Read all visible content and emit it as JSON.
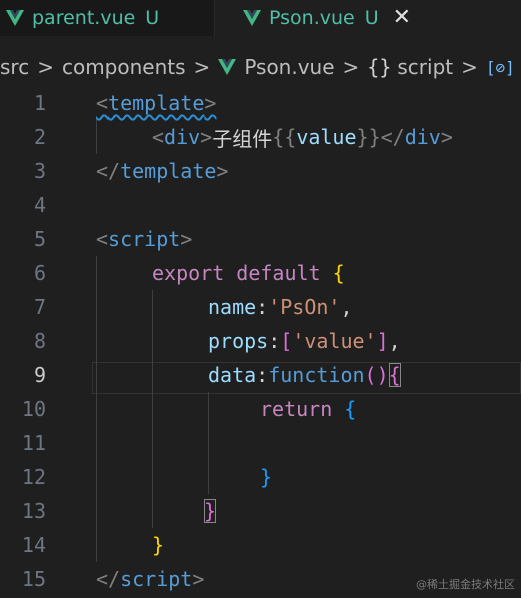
{
  "tabs": [
    {
      "label": "parent.vue",
      "status": "U"
    },
    {
      "label": "Pson.vue",
      "status": "U",
      "close": "✕"
    }
  ],
  "breadcrumb": {
    "items": [
      "src",
      "components",
      "Pson.vue",
      "script"
    ],
    "separator": ">",
    "braces": "{}",
    "symbol_glyph": "[⊘]"
  },
  "editor": {
    "line_numbers": [
      "1",
      "2",
      "3",
      "4",
      "5",
      "6",
      "7",
      "8",
      "9",
      "10",
      "11",
      "12",
      "13",
      "14",
      "15"
    ],
    "current_line": "9",
    "lines": [
      {
        "t1": "<",
        "t2": "template",
        "t3": ">"
      },
      {
        "t1": "<",
        "t2": "div",
        "t3": ">",
        "text": "子组件",
        "m1": "{{",
        "ident": "value",
        "m2": "}}",
        "t4": "</",
        "t5": "div",
        "t6": ">"
      },
      {
        "t1": "</",
        "t2": "template",
        "t3": ">"
      },
      {},
      {
        "t1": "<",
        "t2": "script",
        "t3": ">"
      },
      {
        "kw1": "export",
        "kw2": "default",
        "brace": "{"
      },
      {
        "key": "name",
        "colon": ":",
        "str": "'PsOn'",
        "comma": ","
      },
      {
        "key": "props",
        "colon": ":",
        "bopen": "[",
        "str": "'value'",
        "bclose": "]",
        "comma": ","
      },
      {
        "key": "data",
        "colon": ":",
        "fn": "function",
        "p": "()",
        "brace": "{"
      },
      {
        "kw": "return",
        "brace": "{"
      },
      {},
      {
        "brace": "}"
      },
      {
        "brace": "}"
      },
      {
        "brace": "}"
      },
      {
        "t1": "</",
        "t2": "script",
        "t3": ">"
      }
    ]
  },
  "watermark": "@稀土掘金技术社区",
  "colors": {
    "background": "#1f1f1f",
    "vue_green": "#4fbfa7",
    "tag": "#569cd6",
    "keyword": "#c586c0",
    "string": "#ce9178",
    "property": "#9cdcfe"
  }
}
